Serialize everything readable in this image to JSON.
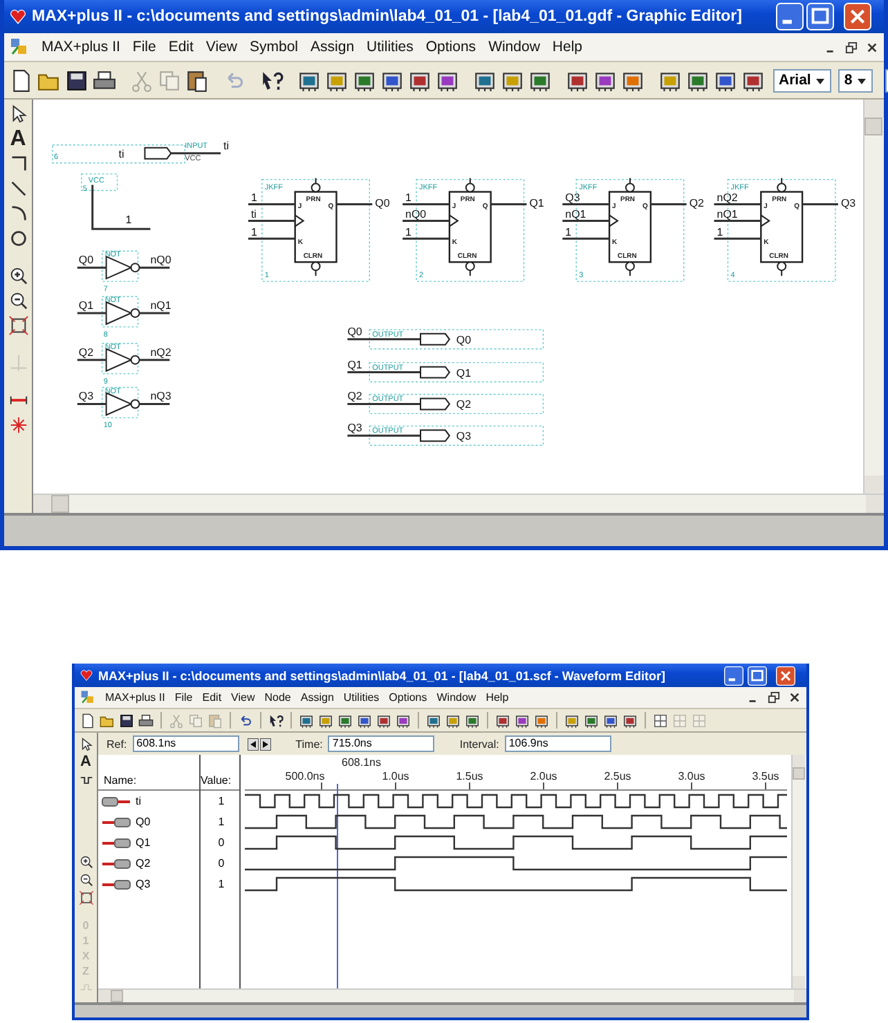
{
  "schematic_window": {
    "title": "MAX+plus II - c:\\documents and settings\\admin\\lab4_01_01 - [lab4_01_01.gdf - Graphic Editor]",
    "menu": [
      "MAX+plus II",
      "File",
      "Edit",
      "View",
      "Symbol",
      "Assign",
      "Utilities",
      "Options",
      "Window",
      "Help"
    ],
    "toolbar": [
      {
        "kind": "new",
        "disabled": false
      },
      {
        "kind": "open",
        "disabled": false
      },
      {
        "kind": "save",
        "disabled": false
      },
      {
        "kind": "print",
        "disabled": false
      },
      {
        "kind": "separator"
      },
      {
        "kind": "cut",
        "disabled": true
      },
      {
        "kind": "copy",
        "disabled": true
      },
      {
        "kind": "paste",
        "disabled": false
      },
      {
        "kind": "separator"
      },
      {
        "kind": "undo",
        "disabled": true
      },
      {
        "kind": "separator"
      },
      {
        "kind": "help",
        "disabled": false
      },
      {
        "kind": "separator"
      },
      {
        "kind": "chip",
        "disabled": false
      },
      {
        "kind": "chip",
        "disabled": false
      },
      {
        "kind": "chip",
        "disabled": false
      },
      {
        "kind": "chip",
        "disabled": false
      },
      {
        "kind": "chip",
        "disabled": false
      },
      {
        "kind": "chip",
        "disabled": false
      },
      {
        "kind": "separator"
      },
      {
        "kind": "chip",
        "disabled": false
      },
      {
        "kind": "chip",
        "disabled": false
      },
      {
        "kind": "chip",
        "disabled": false
      },
      {
        "kind": "separator"
      },
      {
        "kind": "chip",
        "disabled": false
      },
      {
        "kind": "chip",
        "disabled": false
      },
      {
        "kind": "chip",
        "disabled": false
      },
      {
        "kind": "separator"
      },
      {
        "kind": "chip",
        "disabled": false
      },
      {
        "kind": "chip",
        "disabled": false
      },
      {
        "kind": "chip",
        "disabled": false
      },
      {
        "kind": "chip",
        "disabled": false
      }
    ],
    "font_box": {
      "value": "Arial"
    },
    "size_box": {
      "value": "8"
    },
    "tools": [
      {
        "kind": "pointer",
        "disabled": false
      },
      {
        "kind": "text",
        "label": "A",
        "disabled": false
      },
      {
        "kind": "orthogonal-line",
        "disabled": false
      },
      {
        "kind": "diagonal-line",
        "disabled": false
      },
      {
        "kind": "arc",
        "disabled": false
      },
      {
        "kind": "circle",
        "disabled": false
      },
      {
        "kind": "zoom-in",
        "disabled": false
      },
      {
        "kind": "zoom-out",
        "disabled": false
      },
      {
        "kind": "fit",
        "disabled": false
      },
      {
        "kind": "snap",
        "disabled": true
      },
      {
        "kind": "rubberband",
        "disabled": false
      },
      {
        "kind": "connect",
        "disabled": false
      }
    ],
    "schematic": {
      "input_pin": {
        "number": "6",
        "name": "ti",
        "type_label": "INPUT",
        "default_label": "VCC",
        "net_label": "ti"
      },
      "vcc": {
        "number": "5",
        "type_label": "VCC",
        "net_label": "1"
      },
      "flip_flops": [
        {
          "type_label": "JKFF",
          "inputs": [
            "1",
            "ti",
            "1"
          ],
          "output": "Q0",
          "number": "1",
          "pins": [
            "J",
            "K",
            "Q",
            "PRN",
            "CLRN"
          ]
        },
        {
          "type_label": "JKFF",
          "inputs": [
            "1",
            "nQ0",
            "1"
          ],
          "output": "Q1",
          "number": "2",
          "pins": [
            "J",
            "K",
            "Q",
            "PRN",
            "CLRN"
          ]
        },
        {
          "type_label": "JKFF",
          "inputs": [
            "Q3",
            "nQ1",
            "1"
          ],
          "output": "Q2",
          "number": "3",
          "pins": [
            "J",
            "K",
            "Q",
            "PRN",
            "CLRN"
          ]
        },
        {
          "type_label": "JKFF",
          "inputs": [
            "nQ2",
            "nQ1",
            "1"
          ],
          "output": "Q3",
          "number": "4",
          "pins": [
            "J",
            "K",
            "Q",
            "PRN",
            "CLRN"
          ]
        }
      ],
      "inverters": [
        {
          "type_label": "NOT",
          "input": "Q0",
          "output": "nQ0",
          "number": "7"
        },
        {
          "type_label": "NOT",
          "input": "Q1",
          "output": "nQ1",
          "number": "8"
        },
        {
          "type_label": "NOT",
          "input": "Q2",
          "output": "nQ2",
          "number": "9"
        },
        {
          "type_label": "NOT",
          "input": "Q3",
          "output": "nQ3",
          "number": "10"
        }
      ],
      "outputs": [
        {
          "net_label": "Q0",
          "type_label": "OUTPUT",
          "name": "Q0"
        },
        {
          "net_label": "Q1",
          "type_label": "OUTPUT",
          "name": "Q1"
        },
        {
          "net_label": "Q2",
          "type_label": "OUTPUT",
          "name": "Q2"
        },
        {
          "net_label": "Q3",
          "type_label": "OUTPUT",
          "name": "Q3"
        }
      ]
    }
  },
  "waveform_window": {
    "title": "MAX+plus II - c:\\documents and settings\\admin\\lab4_01_01 - [lab4_01_01.scf - Waveform Editor]",
    "menu": [
      "MAX+plus II",
      "File",
      "Edit",
      "View",
      "Node",
      "Assign",
      "Utilities",
      "Options",
      "Window",
      "Help"
    ],
    "toolbar": [
      {
        "kind": "new",
        "disabled": false
      },
      {
        "kind": "open",
        "disabled": false
      },
      {
        "kind": "save",
        "disabled": false
      },
      {
        "kind": "print",
        "disabled": false
      },
      {
        "kind": "separator"
      },
      {
        "kind": "cut",
        "disabled": true
      },
      {
        "kind": "copy",
        "disabled": true
      },
      {
        "kind": "paste",
        "disabled": true
      },
      {
        "kind": "separator"
      },
      {
        "kind": "undo",
        "disabled": false
      },
      {
        "kind": "separator"
      },
      {
        "kind": "help",
        "disabled": false
      },
      {
        "kind": "separator"
      },
      {
        "kind": "chip",
        "disabled": false
      },
      {
        "kind": "chip",
        "disabled": false
      },
      {
        "kind": "chip",
        "disabled": false
      },
      {
        "kind": "chip",
        "disabled": false
      },
      {
        "kind": "chip",
        "disabled": false
      },
      {
        "kind": "chip",
        "disabled": false
      },
      {
        "kind": "separator"
      },
      {
        "kind": "chip",
        "disabled": false
      },
      {
        "kind": "chip",
        "disabled": false
      },
      {
        "kind": "chip",
        "disabled": false
      },
      {
        "kind": "separator"
      },
      {
        "kind": "chip",
        "disabled": false
      },
      {
        "kind": "chip",
        "disabled": false
      },
      {
        "kind": "chip",
        "disabled": false
      },
      {
        "kind": "separator"
      },
      {
        "kind": "chip",
        "disabled": false
      },
      {
        "kind": "chip",
        "disabled": false
      },
      {
        "kind": "chip",
        "disabled": false
      },
      {
        "kind": "chip",
        "disabled": false
      },
      {
        "kind": "separator"
      },
      {
        "kind": "grid",
        "disabled": false
      },
      {
        "kind": "grid",
        "disabled": true
      },
      {
        "kind": "grid",
        "disabled": true
      }
    ],
    "tools": [
      {
        "kind": "pointer",
        "disabled": false
      },
      {
        "kind": "text",
        "label": "A",
        "disabled": false
      },
      {
        "kind": "overwrite",
        "disabled": false
      },
      {
        "kind": "zoom-in",
        "disabled": false
      },
      {
        "kind": "zoom-out",
        "disabled": false
      },
      {
        "kind": "fit",
        "disabled": false
      },
      {
        "kind": "level",
        "label": "0",
        "disabled": true
      },
      {
        "kind": "level",
        "label": "1",
        "disabled": true
      },
      {
        "kind": "level",
        "label": "X",
        "disabled": true
      },
      {
        "kind": "level",
        "label": "Z",
        "disabled": true
      },
      {
        "kind": "invert",
        "disabled": true
      }
    ],
    "ref": {
      "label": "Ref:",
      "value": "608.1ns"
    },
    "time": {
      "label": "Time:",
      "value": "715.0ns"
    },
    "interval": {
      "label": "Interval:",
      "value": "106.9ns"
    },
    "name_header": "Name:",
    "value_header": "Value:",
    "cursor_label": "608.1ns",
    "ticks": [
      "500.0ns",
      "1.0us",
      "1.5us",
      "2.0us",
      "2.5us",
      "3.0us",
      "3.5us"
    ],
    "signals": [
      {
        "kind": "input",
        "name": "ti",
        "value": "1"
      },
      {
        "kind": "output",
        "name": "Q0",
        "value": "1"
      },
      {
        "kind": "output",
        "name": "Q1",
        "value": "0"
      },
      {
        "kind": "output",
        "name": "Q2",
        "value": "0"
      },
      {
        "kind": "output",
        "name": "Q3",
        "value": "1"
      }
    ]
  }
}
